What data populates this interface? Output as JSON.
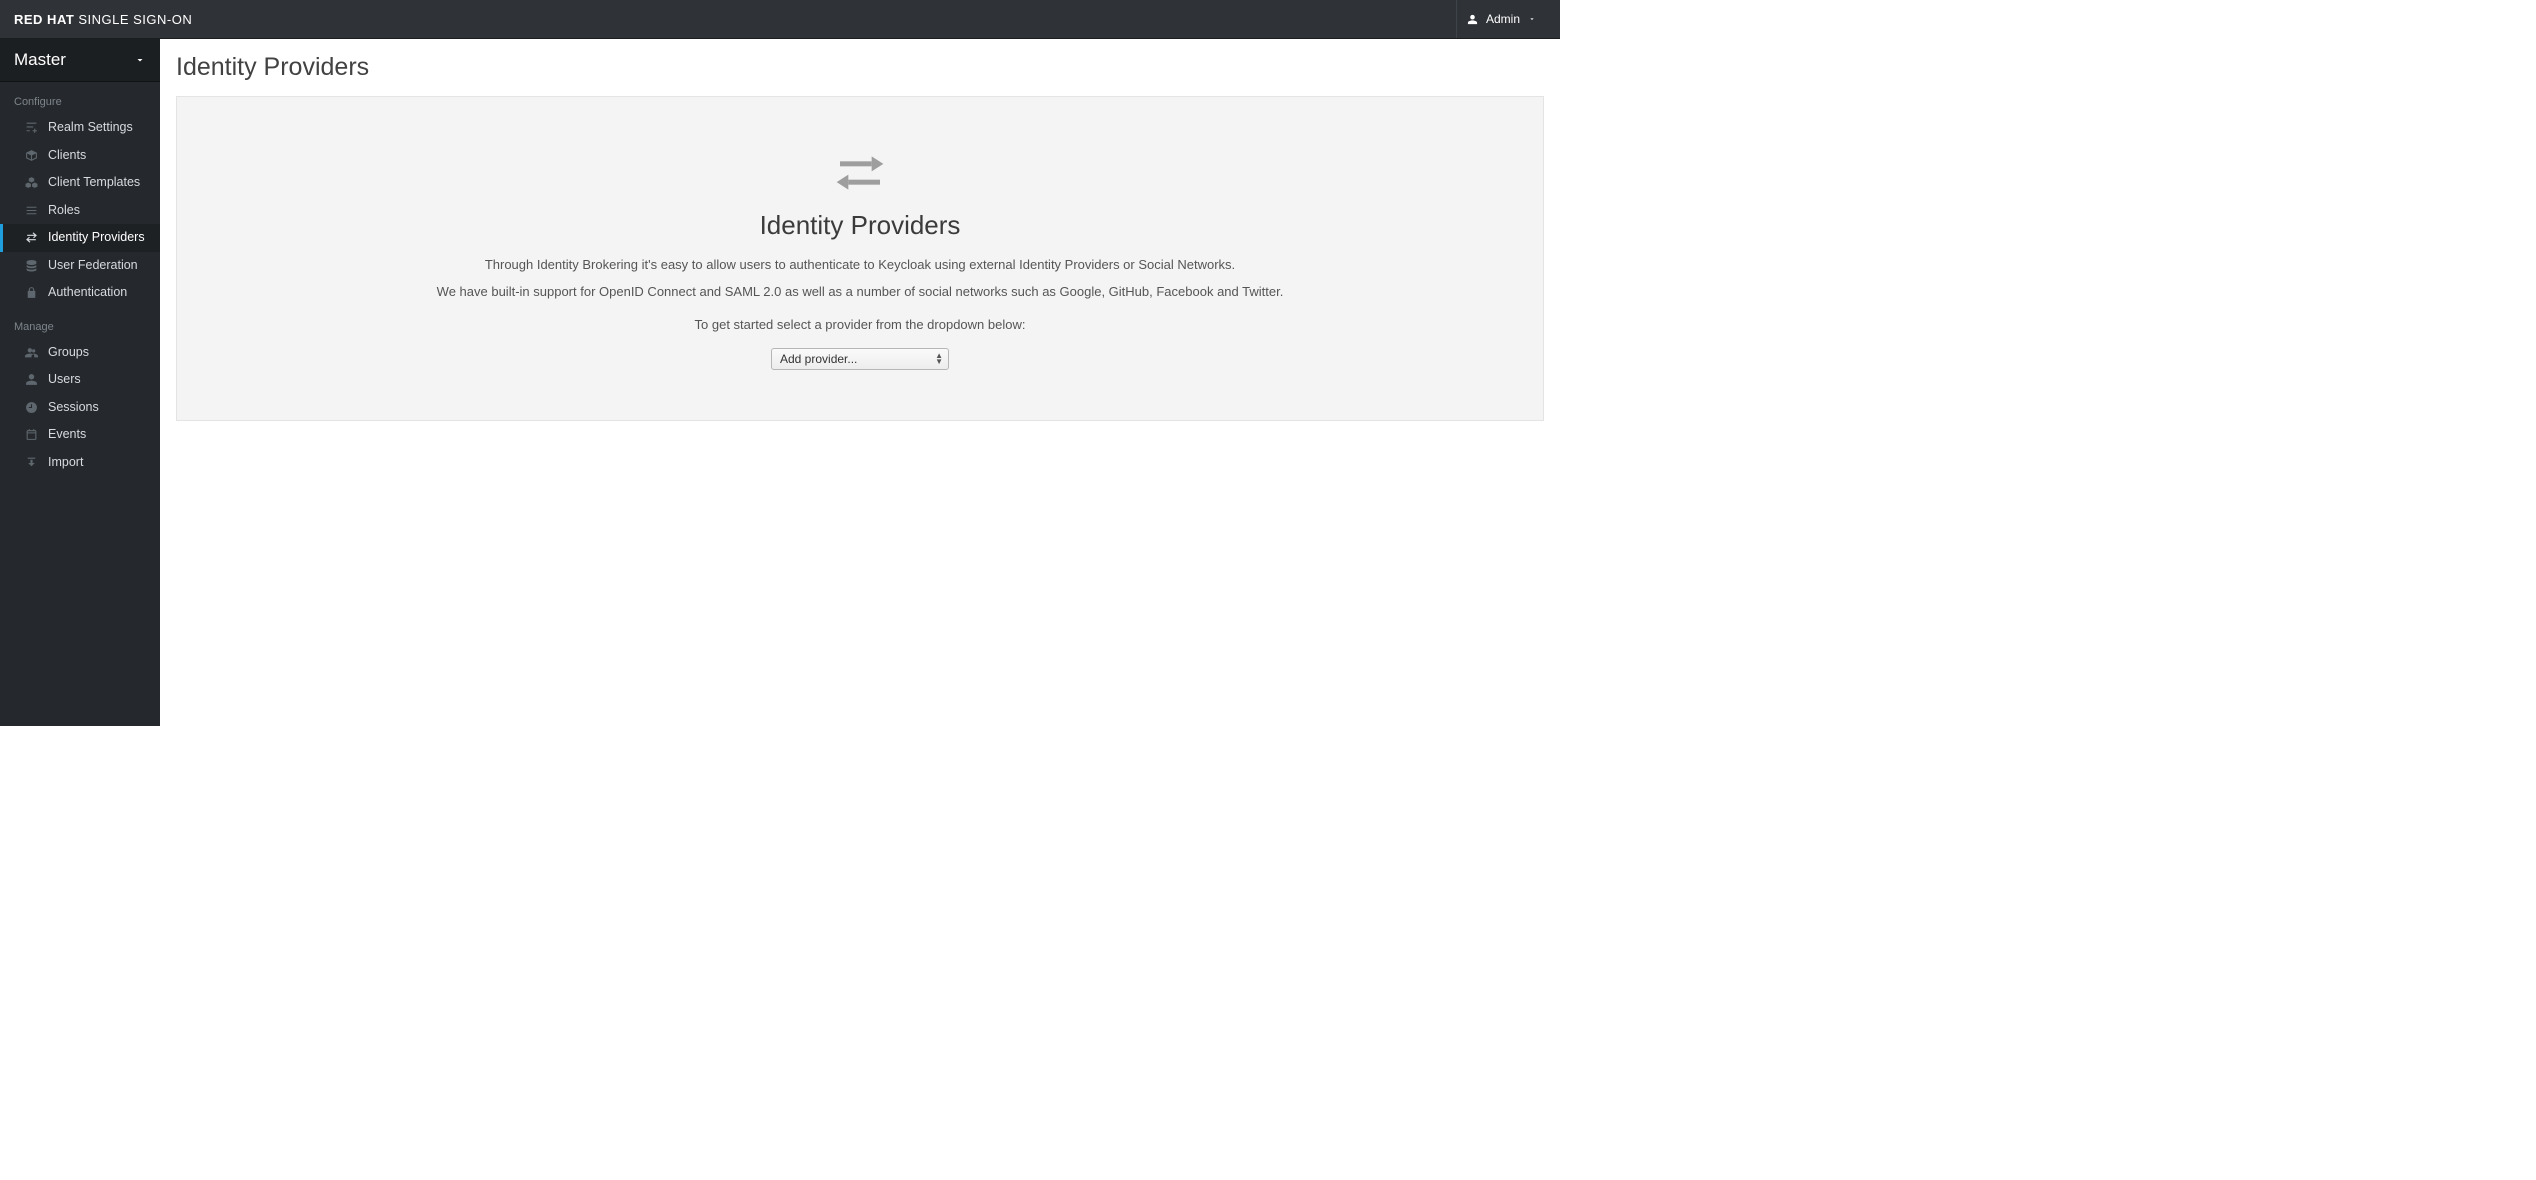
{
  "header": {
    "brand_bold": "RED HAT",
    "brand_thin": "SINGLE SIGN-ON",
    "user_name": "Admin"
  },
  "sidebar": {
    "realm": "Master",
    "sections": {
      "configure": "Configure",
      "manage": "Manage"
    },
    "configure_items": [
      {
        "label": "Realm Settings",
        "icon": "sliders"
      },
      {
        "label": "Clients",
        "icon": "cube"
      },
      {
        "label": "Client Templates",
        "icon": "cubes"
      },
      {
        "label": "Roles",
        "icon": "list"
      },
      {
        "label": "Identity Providers",
        "icon": "exchange",
        "active": true
      },
      {
        "label": "User Federation",
        "icon": "database"
      },
      {
        "label": "Authentication",
        "icon": "lock"
      }
    ],
    "manage_items": [
      {
        "label": "Groups",
        "icon": "users"
      },
      {
        "label": "Users",
        "icon": "user"
      },
      {
        "label": "Sessions",
        "icon": "clock"
      },
      {
        "label": "Events",
        "icon": "calendar"
      },
      {
        "label": "Import",
        "icon": "download"
      }
    ]
  },
  "main": {
    "page_title": "Identity Providers",
    "blank": {
      "title": "Identity Providers",
      "desc1": "Through Identity Brokering it's easy to allow users to authenticate to Keycloak using external Identity Providers or Social Networks.",
      "desc2": "We have built-in support for OpenID Connect and SAML 2.0 as well as a number of social networks such as Google, GitHub, Facebook and Twitter.",
      "cta": "To get started select a provider from the dropdown below:",
      "select_placeholder": "Add provider..."
    }
  }
}
